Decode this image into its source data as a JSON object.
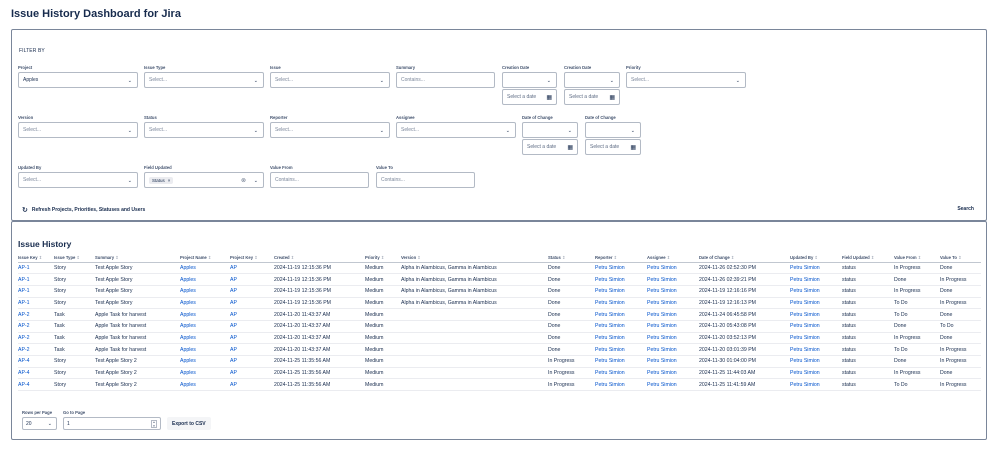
{
  "page": {
    "title": "Issue History Dashboard for Jira"
  },
  "filters": {
    "heading": "FILTER BY",
    "project": {
      "label": "Project",
      "value": "Apples"
    },
    "issue_type": {
      "label": "Issue Type",
      "placeholder": "Select..."
    },
    "issue": {
      "label": "Issue",
      "placeholder": "Select..."
    },
    "summary": {
      "label": "Summary",
      "placeholder": "Contains..."
    },
    "creation_date_from": {
      "label": "Creation Date",
      "date_placeholder": "Select a date"
    },
    "creation_date_to": {
      "label": "Creation Date",
      "date_placeholder": "Select a date"
    },
    "priority": {
      "label": "Priority",
      "placeholder": "Select..."
    },
    "version": {
      "label": "Version",
      "placeholder": "Select..."
    },
    "status": {
      "label": "Status",
      "placeholder": "Select..."
    },
    "reporter": {
      "label": "Reporter",
      "placeholder": "Select..."
    },
    "assignee": {
      "label": "Assignee",
      "placeholder": "Select..."
    },
    "date_of_change_from": {
      "label": "Date of Change",
      "date_placeholder": "Select a date"
    },
    "date_of_change_to": {
      "label": "Date of Change",
      "date_placeholder": "Select a date"
    },
    "updated_by": {
      "label": "Updated By",
      "placeholder": "Select..."
    },
    "field_updated": {
      "label": "Field Updated",
      "tag": "Status"
    },
    "value_from": {
      "label": "Value From",
      "placeholder": "Contains..."
    },
    "value_to": {
      "label": "Value To",
      "placeholder": "Contains..."
    },
    "refresh_label": "Refresh Projects, Priorities, Statuses and Users",
    "search_label": "Search"
  },
  "results": {
    "title": "Issue History",
    "columns": [
      "Issue Key",
      "Issue Type",
      "Summary",
      "Project Name",
      "Project Key",
      "Created",
      "Priority",
      "Version",
      "Status",
      "Reporter",
      "Assignee",
      "Date of Change",
      "Updated By",
      "Field Updated",
      "Value From",
      "Value To"
    ],
    "rows": [
      [
        "AP-1",
        "Story",
        "Test Apple Story",
        "Apples",
        "AP",
        "2024-11-19 12:15:36 PM",
        "Medium",
        "Alpha in Alambicus, Gamma in Alambicus",
        "Done",
        "Petru Simion",
        "Petru Simion",
        "2024-11-26 02:52:30 PM",
        "Petru Simion",
        "status",
        "In Progress",
        "Done"
      ],
      [
        "AP-1",
        "Story",
        "Test Apple Story",
        "Apples",
        "AP",
        "2024-11-19 12:15:36 PM",
        "Medium",
        "Alpha in Alambicus, Gamma in Alambicus",
        "Done",
        "Petru Simion",
        "Petru Simion",
        "2024-11-26 02:39:21 PM",
        "Petru Simion",
        "status",
        "Done",
        "In Progress"
      ],
      [
        "AP-1",
        "Story",
        "Test Apple Story",
        "Apples",
        "AP",
        "2024-11-19 12:15:36 PM",
        "Medium",
        "Alpha in Alambicus, Gamma in Alambicus",
        "Done",
        "Petru Simion",
        "Petru Simion",
        "2024-11-19 12:16:16 PM",
        "Petru Simion",
        "status",
        "In Progress",
        "Done"
      ],
      [
        "AP-1",
        "Story",
        "Test Apple Story",
        "Apples",
        "AP",
        "2024-11-19 12:15:36 PM",
        "Medium",
        "Alpha in Alambicus, Gamma in Alambicus",
        "Done",
        "Petru Simion",
        "Petru Simion",
        "2024-11-19 12:16:13 PM",
        "Petru Simion",
        "status",
        "To Do",
        "In Progress"
      ],
      [
        "AP-2",
        "Task",
        "Apple Task for harvest",
        "Apples",
        "AP",
        "2024-11-20 11:43:37 AM",
        "Medium",
        "",
        "Done",
        "Petru Simion",
        "Petru Simion",
        "2024-11-24 06:45:58 PM",
        "Petru Simion",
        "status",
        "To Do",
        "Done"
      ],
      [
        "AP-2",
        "Task",
        "Apple Task for harvest",
        "Apples",
        "AP",
        "2024-11-20 11:43:37 AM",
        "Medium",
        "",
        "Done",
        "Petru Simion",
        "Petru Simion",
        "2024-11-20 05:43:08 PM",
        "Petru Simion",
        "status",
        "Done",
        "To Do"
      ],
      [
        "AP-2",
        "Task",
        "Apple Task for harvest",
        "Apples",
        "AP",
        "2024-11-20 11:43:37 AM",
        "Medium",
        "",
        "Done",
        "Petru Simion",
        "Petru Simion",
        "2024-11-20 03:52:13 PM",
        "Petru Simion",
        "status",
        "In Progress",
        "Done"
      ],
      [
        "AP-2",
        "Task",
        "Apple Task for harvest",
        "Apples",
        "AP",
        "2024-11-20 11:43:37 AM",
        "Medium",
        "",
        "Done",
        "Petru Simion",
        "Petru Simion",
        "2024-11-20 03:01:39 PM",
        "Petru Simion",
        "status",
        "To Do",
        "In Progress"
      ],
      [
        "AP-4",
        "Story",
        "Test Apple Story 2",
        "Apples",
        "AP",
        "2024-11-25 11:35:56 AM",
        "Medium",
        "",
        "In Progress",
        "Petru Simion",
        "Petru Simion",
        "2024-11-30 01:04:00 PM",
        "Petru Simion",
        "status",
        "Done",
        "In Progress"
      ],
      [
        "AP-4",
        "Story",
        "Test Apple Story 2",
        "Apples",
        "AP",
        "2024-11-25 11:35:56 AM",
        "Medium",
        "",
        "In Progress",
        "Petru Simion",
        "Petru Simion",
        "2024-11-25 11:44:03 AM",
        "Petru Simion",
        "status",
        "In Progress",
        "Done"
      ],
      [
        "AP-4",
        "Story",
        "Test Apple Story 2",
        "Apples",
        "AP",
        "2024-11-25 11:35:56 AM",
        "Medium",
        "",
        "In Progress",
        "Petru Simion",
        "Petru Simion",
        "2024-11-25 11:41:59 AM",
        "Petru Simion",
        "status",
        "To Do",
        "In Progress"
      ]
    ]
  },
  "pagination": {
    "rows_per_page_label": "Rows per Page",
    "rows_per_page_value": "20",
    "go_to_page_label": "Go to Page",
    "go_to_page_value": "1",
    "export_label": "Export to CSV"
  }
}
